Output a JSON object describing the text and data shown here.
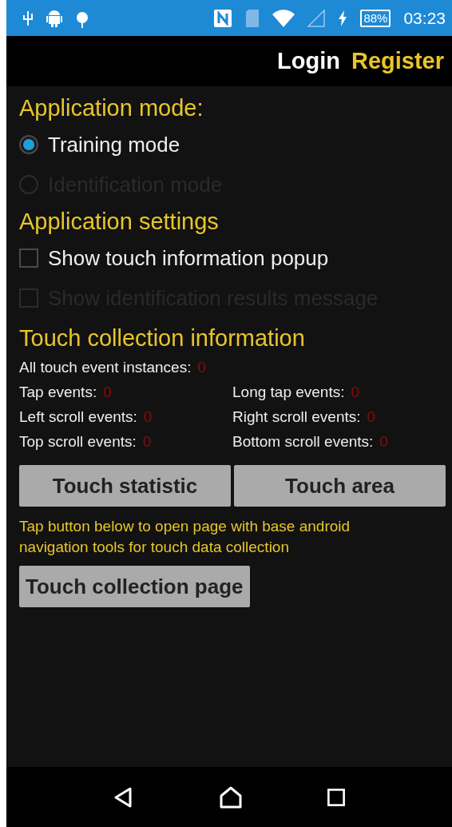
{
  "status_bar": {
    "battery": "88%",
    "time": "03:23"
  },
  "action_bar": {
    "links": [
      {
        "label": "Login",
        "selected": false
      },
      {
        "label": "Register",
        "selected": true
      }
    ]
  },
  "application_mode": {
    "title": "Application mode:",
    "options": [
      {
        "label": "Training mode",
        "selected": true,
        "disabled": false
      },
      {
        "label": "Identification mode",
        "selected": false,
        "disabled": true
      }
    ]
  },
  "application_settings": {
    "title": "Application settings",
    "options": [
      {
        "label": "Show touch information popup",
        "checked": false,
        "disabled": false
      },
      {
        "label": "Show identification results message",
        "checked": false,
        "disabled": true
      }
    ]
  },
  "touch_info": {
    "title": "Touch collection information",
    "total": {
      "label": "All touch event instances:",
      "value": "0"
    },
    "stats": [
      {
        "label": "Tap events:",
        "value": "0"
      },
      {
        "label": "Long tap events:",
        "value": "0"
      },
      {
        "label": "Left scroll events:",
        "value": "0"
      },
      {
        "label": "Right scroll events:",
        "value": "0"
      },
      {
        "label": "Top scroll events:",
        "value": "0"
      },
      {
        "label": "Bottom scroll events:",
        "value": "0"
      }
    ]
  },
  "buttons": [
    "Touch statistic",
    "Touch area"
  ],
  "hint": "Tap button below to open page with base android navigation tools for touch data collection",
  "collection_button": "Touch collection page"
}
